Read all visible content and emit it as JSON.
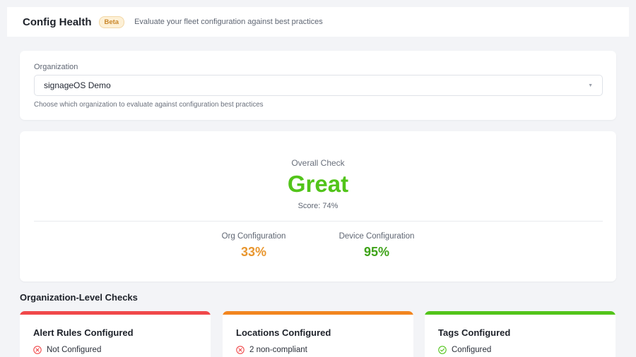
{
  "header": {
    "title": "Config Health",
    "badge": "Beta",
    "subtitle": "Evaluate your fleet configuration against best practices"
  },
  "organization": {
    "label": "Organization",
    "selected": "signageOS Demo",
    "help": "Choose which organization to evaluate against configuration best practices"
  },
  "overall": {
    "label": "Overall Check",
    "value": "Great",
    "score": "Score: 74%",
    "org_label": "Org Configuration",
    "org_value": "33%",
    "device_label": "Device Configuration",
    "device_value": "95%"
  },
  "section_title": "Organization-Level Checks",
  "checks": [
    {
      "title": "Alert Rules Configured",
      "status": "Not Configured",
      "color": "#f0484a",
      "icon": "x-circle-icon"
    },
    {
      "title": "Locations Configured",
      "status": "2 non-compliant",
      "color": "#f2851f",
      "icon": "x-circle-icon"
    },
    {
      "title": "Tags Configured",
      "status": "Configured",
      "color": "#52c41a",
      "icon": "check-circle-icon"
    }
  ]
}
